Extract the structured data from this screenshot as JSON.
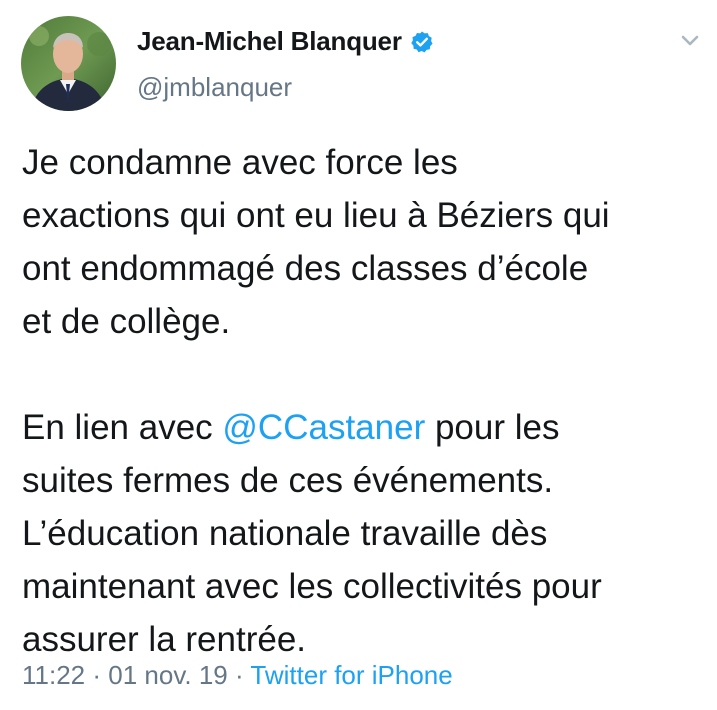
{
  "author": {
    "display_name": "Jean-Michel Blanquer",
    "handle": "@jmblanquer",
    "verified": true
  },
  "tweet": {
    "paragraph1_lines": [
      "Je condamne avec force les",
      "exactions qui ont eu lieu à Béziers qui",
      "ont endommagé des classes d’école",
      "et de collège."
    ],
    "paragraph2_line1_before": "En lien avec ",
    "paragraph2_mention": "@CCastaner",
    "paragraph2_line1_after": " pour les",
    "paragraph2_lines": [
      "suites fermes de ces événements.",
      "L’éducation nationale travaille dès",
      "maintenant avec les collectivités pour",
      "assurer la rentrée."
    ]
  },
  "meta": {
    "time": "11:22",
    "separator": " · ",
    "date": "01 nov. 19",
    "source": "Twitter for iPhone"
  },
  "colors": {
    "text": "#14171a",
    "secondary": "#657786",
    "link": "#1da1f2",
    "verified": "#1da1f2"
  },
  "icons": {
    "verified": "verified-badge-icon",
    "caret": "chevron-down-icon"
  }
}
